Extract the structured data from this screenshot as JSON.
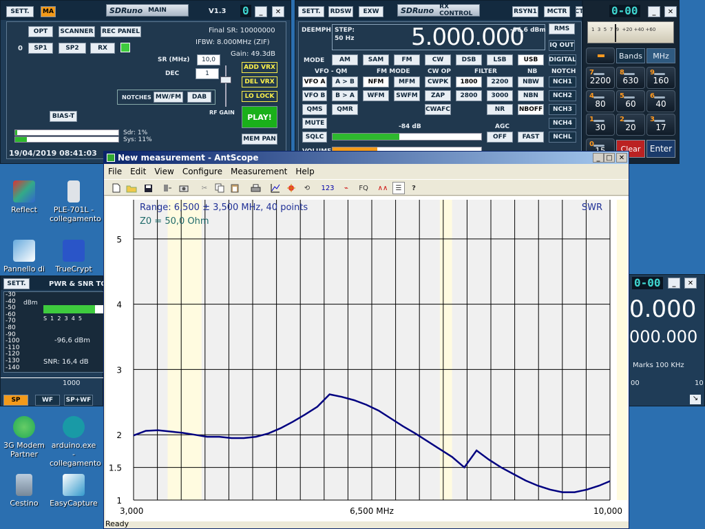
{
  "desktop": {
    "icons": [
      {
        "label": "Reflect"
      },
      {
        "label": "PLE-701L - collegamento"
      },
      {
        "label": "Pannello di"
      },
      {
        "label": "TrueCrypt"
      },
      {
        "label": "3G Modem Partner"
      },
      {
        "label": "arduino.exe - collegamento"
      },
      {
        "label": "Cestino"
      },
      {
        "label": "EasyCapture"
      }
    ]
  },
  "main_panel": {
    "sett": "SETT.",
    "ma": "MA",
    "title": "SDRuno",
    "subtitle": "MAIN",
    "version": "V1.3",
    "counter": "0",
    "buttons": {
      "opt": "OPT",
      "scanner": "SCANNER",
      "rec_panel": "REC PANEL",
      "sp1": "SP1",
      "sp2": "SP2",
      "rx": "RX",
      "bias_t": "BIAS-T",
      "add_vrx": "ADD VRX",
      "del_vrx": "DEL VRX",
      "lo_lock": "LO LOCK",
      "play": "PLAY!",
      "mem_pan": "MEM PAN",
      "mw_fm": "MW/FM",
      "dab": "DAB"
    },
    "rx_index": "0",
    "final_sr": "Final SR: 10000000",
    "ifbw": "IFBW: 8.000MHz (ZIF)",
    "gain": "Gain: 49.3dB",
    "sr_label": "SR (MHz)",
    "sr_value": "10,0",
    "dec_label": "DEC",
    "dec_value": "1",
    "notches_label": "NOTCHES",
    "rf_gain": "RF GAIN",
    "sdr": "Sdr: 1%",
    "sys": "Sys: 11%",
    "datetime": "19/04/2019 08:41:03"
  },
  "rx_control": {
    "sett": "SETT.",
    "rdsw": "RDSW",
    "exw": "EXW",
    "title": "SDRuno",
    "subtitle": "RX CONTROL",
    "rsyn1": "RSYN1",
    "mctr": "MCTR",
    "tctr": "TCTR",
    "counter": "0-00",
    "deemph": "DEEMPH",
    "step_label": "STEP:",
    "step_value": "50 Hz",
    "frequency": "5.000.000",
    "signal": "-96,6 dBm",
    "rms": "RMS",
    "iq_out": "IQ OUT",
    "mode_label": "MODE",
    "modes": [
      "AM",
      "SAM",
      "FM",
      "CW",
      "DSB",
      "LSB",
      "USB",
      "DIGITAL"
    ],
    "headers": {
      "vfo_qm": "VFO - QM",
      "fm_mode": "FM MODE",
      "cw_op": "CW OP",
      "filter": "FILTER",
      "nb": "NB",
      "notch": "NOTCH",
      "agc": "AGC"
    },
    "row1": [
      "VFO A",
      "A > B",
      "NFM",
      "MFM",
      "CWPK",
      "1800",
      "2200",
      "NBW",
      "NCH1"
    ],
    "row2": [
      "VFO B",
      "B > A",
      "WFM",
      "SWFM",
      "ZAP",
      "2800",
      "3000",
      "NBN",
      "NCH2"
    ],
    "row3": [
      "QMS",
      "QMR",
      "CWAFC",
      "NR",
      "NBOFF",
      "NCH3"
    ],
    "mute": "MUTE",
    "nch4": "NCH4",
    "sqlc": "SQLC",
    "sql_level": "-84 dB",
    "sql_fraction": 0.45,
    "agc_off": "OFF",
    "agc_fast": "FAST",
    "nchl": "NCHL",
    "volume": "VOLUME"
  },
  "keypad": {
    "bands": "Bands",
    "mhz": "MHz",
    "scale": "1  3  5  7  9  +20 +40 +60",
    "keys": [
      {
        "n": "7",
        "v": "2200"
      },
      {
        "n": "8",
        "v": "630"
      },
      {
        "n": "9",
        "v": "160"
      },
      {
        "n": "4",
        "v": "80"
      },
      {
        "n": "5",
        "v": "60"
      },
      {
        "n": "6",
        "v": "40"
      },
      {
        "n": "1",
        "v": "30"
      },
      {
        "n": "2",
        "v": "20"
      },
      {
        "n": "3",
        "v": "17"
      }
    ],
    "zero": {
      "n": "0",
      "v": "15"
    },
    "clear": "Clear",
    "enter": "Enter"
  },
  "pwr_panel": {
    "sett": "SETT.",
    "title": "PWR & SNR TO",
    "dbm_label": "dBm",
    "scale": [
      "-30",
      "-40",
      "-50",
      "-60",
      "-70",
      "-80",
      "-90",
      "-100",
      "-110",
      "-120",
      "-130",
      "-140"
    ],
    "s_scale": "S  1  2  3  4  5",
    "level": "-96,6 dBm",
    "snr": "SNR: 16,4 dB",
    "freq_tick": "1000",
    "sp": "SP",
    "wf": "WF",
    "spwf": "SP+WF"
  },
  "sp_panel": {
    "counter": "0-00",
    "freq1": "0.000",
    "freq2": "000.000",
    "marks": "Marks 100 KHz",
    "tick_left": "00",
    "tick_right": "10"
  },
  "antscope": {
    "title": "New measurement - AntScope",
    "menu": [
      "File",
      "Edit",
      "View",
      "Configure",
      "Measurement",
      "Help"
    ],
    "toolbar_text": {
      "n123": "123",
      "fq": "FQ"
    },
    "status": "Ready"
  },
  "chart_data": {
    "type": "line",
    "title": "SWR",
    "range_text": "Range: 6,500 ± 3,500 MHz, 40 points",
    "z0_text": "Z0 = 50,0 Ohm",
    "xlim": [
      3.0,
      10.0
    ],
    "x_ticks": [
      "3,000",
      "6,500 MHz",
      "10,000"
    ],
    "y_ticks": [
      "1",
      "1.5",
      "2",
      "3",
      "4",
      "5"
    ],
    "y_tick_values": [
      1,
      1.5,
      2,
      3,
      4,
      5
    ],
    "ylim": [
      1,
      5.6
    ],
    "grid": true,
    "series": [
      {
        "color": "#000080",
        "x": [
          3.0,
          3.18,
          3.36,
          3.54,
          3.72,
          3.9,
          4.08,
          4.26,
          4.44,
          4.62,
          4.8,
          4.98,
          5.16,
          5.34,
          5.52,
          5.7,
          5.88,
          6.06,
          6.24,
          6.42,
          6.6,
          6.78,
          6.96,
          7.14,
          7.32,
          7.5,
          7.68,
          7.86,
          8.04,
          8.22,
          8.4,
          8.58,
          8.76,
          8.94,
          9.12,
          9.3,
          9.48,
          9.66,
          9.84,
          10.0
        ],
        "y": [
          1.99,
          2.06,
          2.07,
          2.05,
          2.03,
          2.0,
          1.97,
          1.97,
          1.95,
          1.95,
          1.97,
          2.02,
          2.1,
          2.2,
          2.31,
          2.43,
          2.62,
          2.58,
          2.53,
          2.46,
          2.37,
          2.25,
          2.13,
          2.02,
          1.9,
          1.78,
          1.66,
          1.5,
          1.76,
          1.62,
          1.5,
          1.4,
          1.3,
          1.22,
          1.16,
          1.12,
          1.12,
          1.16,
          1.22,
          1.29
        ]
      }
    ]
  }
}
